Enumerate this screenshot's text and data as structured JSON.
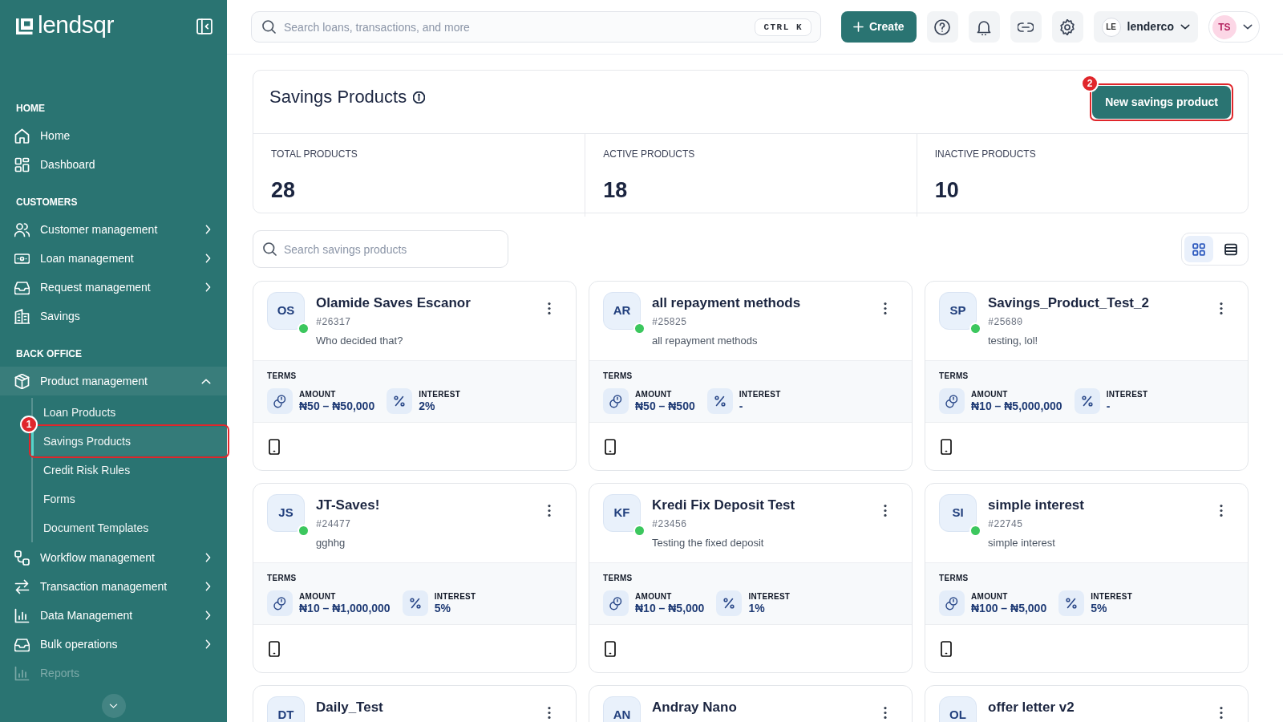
{
  "sidebar": {
    "brand": "lendsqr",
    "sections": [
      {
        "title": "HOME",
        "items": [
          {
            "label": "Home",
            "kind": "link",
            "disabled": false
          },
          {
            "label": "Dashboard",
            "kind": "link",
            "disabled": false
          }
        ]
      },
      {
        "title": "CUSTOMERS",
        "items": [
          {
            "label": "Customer management",
            "kind": "group",
            "expanded": false,
            "disabled": false
          },
          {
            "label": "Loan management",
            "kind": "group",
            "expanded": false,
            "disabled": false
          },
          {
            "label": "Request management",
            "kind": "group",
            "expanded": false,
            "disabled": false
          },
          {
            "label": "Savings",
            "kind": "link",
            "disabled": false
          }
        ]
      },
      {
        "title": "BACK OFFICE",
        "items": [
          {
            "label": "Product management",
            "kind": "group",
            "expanded": true,
            "disabled": false,
            "children": [
              {
                "label": "Loan Products",
                "selected": false
              },
              {
                "label": "Savings Products",
                "selected": true,
                "callout": "1"
              },
              {
                "label": "Credit Risk Rules",
                "selected": false
              },
              {
                "label": "Forms",
                "selected": false
              },
              {
                "label": "Document Templates",
                "selected": false
              }
            ]
          },
          {
            "label": "Workflow management",
            "kind": "group",
            "expanded": false,
            "disabled": false
          },
          {
            "label": "Transaction management",
            "kind": "group",
            "expanded": false,
            "disabled": false
          },
          {
            "label": "Data Management",
            "kind": "group",
            "expanded": false,
            "disabled": false
          },
          {
            "label": "Bulk operations",
            "kind": "group",
            "expanded": false,
            "disabled": false
          },
          {
            "label": "Reports",
            "kind": "link",
            "disabled": true
          }
        ]
      }
    ]
  },
  "topbar": {
    "search": {
      "placeholder": "Search loans, transactions, and more",
      "shortcut": "CTRL K"
    },
    "create_button": "Create",
    "organization": {
      "initials": "LE",
      "name": "lenderco"
    },
    "user": {
      "initials": "TS"
    }
  },
  "header": {
    "title": "Savings Products",
    "new_button": {
      "label": "New savings product",
      "callout": "2"
    },
    "stats": [
      {
        "label": "TOTAL PRODUCTS",
        "value": "28"
      },
      {
        "label": "ACTIVE PRODUCTS",
        "value": "18"
      },
      {
        "label": "INACTIVE PRODUCTS",
        "value": "10"
      }
    ]
  },
  "search": {
    "placeholder": "Search savings products"
  },
  "views": [
    {
      "kind": "grid",
      "selected": true
    },
    {
      "kind": "list",
      "selected": false
    }
  ],
  "products": [
    {
      "initials": "OS",
      "name": "Olamide Saves Escanor",
      "code": "#26317",
      "description": "Who decided that?",
      "active": true,
      "terms_label": "TERMS",
      "amount_label": "AMOUNT",
      "amount": "₦50 – ₦50,000",
      "interest_label": "INTEREST",
      "interest": "2%"
    },
    {
      "initials": "AR",
      "name": "all repayment methods",
      "code": "#25825",
      "description": "all repayment methods",
      "active": true,
      "terms_label": "TERMS",
      "amount_label": "AMOUNT",
      "amount": "₦50 – ₦500",
      "interest_label": "INTEREST",
      "interest": "-"
    },
    {
      "initials": "SP",
      "name": "Savings_Product_Test_2",
      "code": "#25680",
      "description": "testing, lol!",
      "active": true,
      "terms_label": "TERMS",
      "amount_label": "AMOUNT",
      "amount": "₦10 – ₦5,000,000",
      "interest_label": "INTEREST",
      "interest": "-"
    },
    {
      "initials": "JS",
      "name": "JT-Saves!",
      "code": "#24477",
      "description": "gghhg",
      "active": true,
      "terms_label": "TERMS",
      "amount_label": "AMOUNT",
      "amount": "₦10 – ₦1,000,000",
      "interest_label": "INTEREST",
      "interest": "5%"
    },
    {
      "initials": "KF",
      "name": "Kredi Fix Deposit Test",
      "code": "#23456",
      "description": "Testing the fixed deposit",
      "active": true,
      "terms_label": "TERMS",
      "amount_label": "AMOUNT",
      "amount": "₦10 – ₦5,000",
      "interest_label": "INTEREST",
      "interest": "1%"
    },
    {
      "initials": "SI",
      "name": "simple interest",
      "code": "#22745",
      "description": "simple interest",
      "active": true,
      "terms_label": "TERMS",
      "amount_label": "AMOUNT",
      "amount": "₦100 – ₦5,000",
      "interest_label": "INTEREST",
      "interest": "5%"
    },
    {
      "initials": "DT",
      "name": "Daily_Test"
    },
    {
      "initials": "AN",
      "name": "Andray Nano"
    },
    {
      "initials": "OL",
      "name": "offer letter v2"
    }
  ]
}
